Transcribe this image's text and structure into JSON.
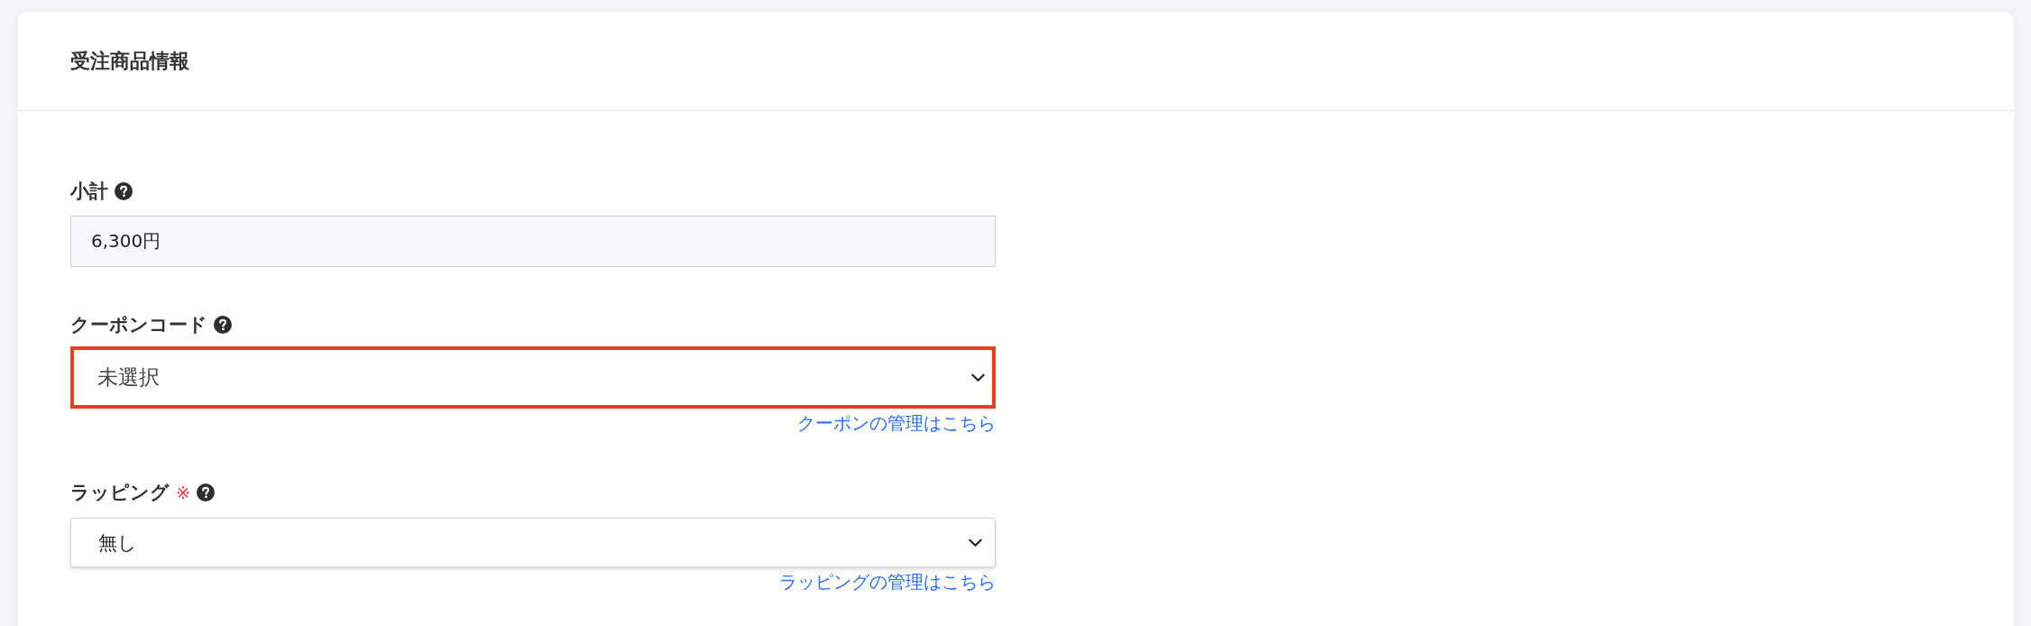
{
  "card": {
    "title": "受注商品情報"
  },
  "fields": [
    {
      "kind": "readonly",
      "label": "小計",
      "help": true,
      "value": "6,300円"
    },
    {
      "kind": "select",
      "label": "クーポンコード",
      "help": true,
      "value": "未選択",
      "highlighted": true,
      "link": "クーポンの管理はこちら"
    },
    {
      "kind": "select",
      "label": "ラッピング",
      "required_mark": "※",
      "help": true,
      "value": "無し",
      "highlighted": false,
      "link": "ラッピングの管理はこちら"
    }
  ]
}
